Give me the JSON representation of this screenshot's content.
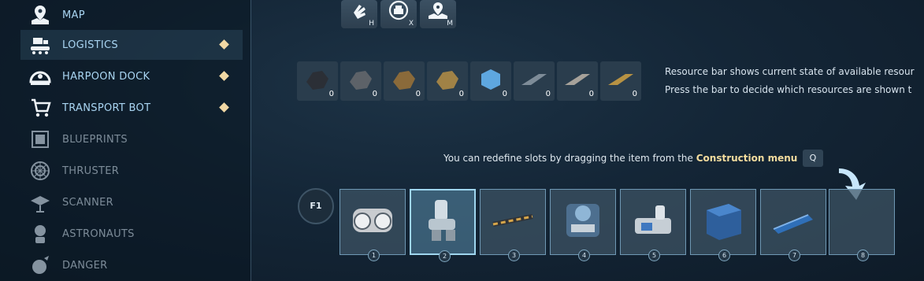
{
  "sidebar": {
    "items": [
      {
        "label": "MAP",
        "icon": "map-pin-icon",
        "state": "enabled",
        "badge": false
      },
      {
        "label": "LOGISTICS",
        "icon": "logistics-icon",
        "state": "active",
        "badge": true
      },
      {
        "label": "HARPOON DOCK",
        "icon": "harpoon-dock-icon",
        "state": "enabled",
        "badge": true
      },
      {
        "label": "TRANSPORT BOT",
        "icon": "cart-icon",
        "state": "enabled",
        "badge": true
      },
      {
        "label": "BLUEPRINTS",
        "icon": "blueprint-icon",
        "state": "disabled",
        "badge": false
      },
      {
        "label": "THRUSTER",
        "icon": "thruster-icon",
        "state": "disabled",
        "badge": false
      },
      {
        "label": "SCANNER",
        "icon": "scanner-icon",
        "state": "disabled",
        "badge": false
      },
      {
        "label": "ASTRONAUTS",
        "icon": "astronaut-icon",
        "state": "disabled",
        "badge": false
      },
      {
        "label": "DANGER",
        "icon": "danger-icon",
        "state": "disabled",
        "badge": false
      }
    ]
  },
  "hotkeys": [
    {
      "key": "H",
      "icon": "hand-icon"
    },
    {
      "key": "X",
      "icon": "inventory-icon"
    },
    {
      "key": "M",
      "icon": "map-icon"
    }
  ],
  "resources": [
    {
      "name": "coal",
      "count": "0",
      "color": "#2b2f36"
    },
    {
      "name": "iron-ore",
      "count": "0",
      "color": "#5d6268"
    },
    {
      "name": "copper-ore",
      "count": "0",
      "color": "#8a6a3a"
    },
    {
      "name": "gold-ore",
      "count": "0",
      "color": "#a08246"
    },
    {
      "name": "ice",
      "count": "0",
      "color": "#5ea7e0"
    },
    {
      "name": "steel-bar",
      "count": "0",
      "color": "#7e8c98"
    },
    {
      "name": "iron-bar",
      "count": "0",
      "color": "#a7a29a"
    },
    {
      "name": "gold-bar",
      "count": "0",
      "color": "#b79243"
    }
  ],
  "info": {
    "line1": "Resource bar shows current state of available resour",
    "line2": "Press the bar to decide which resources are shown t"
  },
  "hint": {
    "prefix": "You can redefine slots by dragging the item from the ",
    "highlight": "Construction menu",
    "key": "Q"
  },
  "hotbar": {
    "selector_label": "F1",
    "slots": [
      {
        "number": "1",
        "icon": "generator-icon",
        "selected": false
      },
      {
        "number": "2",
        "icon": "pipe-junction-icon",
        "selected": true
      },
      {
        "number": "3",
        "icon": "drill-icon",
        "selected": false
      },
      {
        "number": "4",
        "icon": "machine-icon",
        "selected": false
      },
      {
        "number": "5",
        "icon": "refinery-icon",
        "selected": false
      },
      {
        "number": "6",
        "icon": "wall-block-icon",
        "selected": false
      },
      {
        "number": "7",
        "icon": "beam-icon",
        "selected": false
      },
      {
        "number": "8",
        "icon": "",
        "selected": false
      }
    ]
  }
}
